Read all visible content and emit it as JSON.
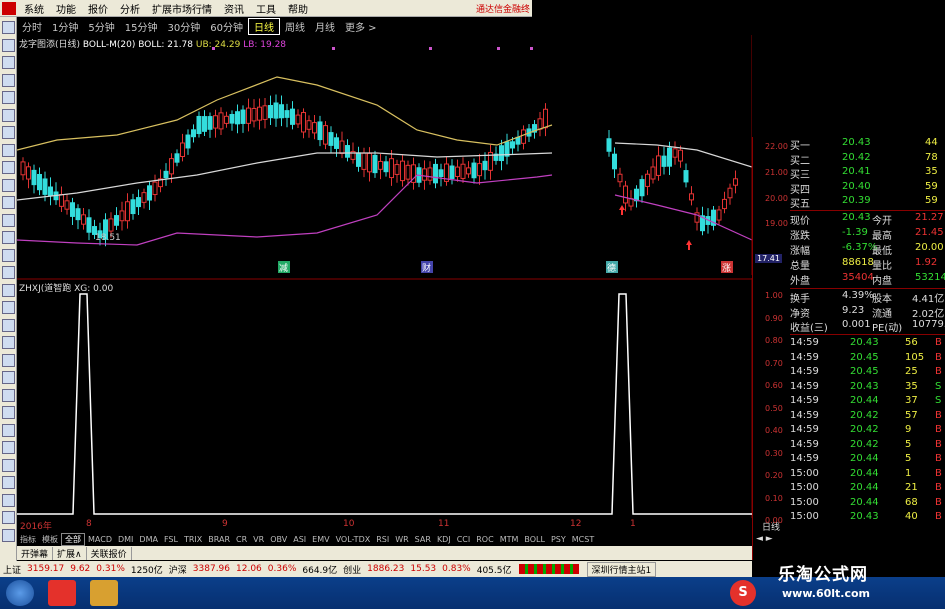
{
  "menu": {
    "items": [
      "系统",
      "功能",
      "报价",
      "分析",
      "扩展市场行情",
      "资讯",
      "工具",
      "帮助"
    ],
    "hint": "通达信金融终"
  },
  "periods": {
    "items": [
      "分时",
      "1分钟",
      "5分钟",
      "15分钟",
      "30分钟",
      "60分钟",
      "日线",
      "周线",
      "月线",
      "更多 >"
    ],
    "active_index": 6
  },
  "main_legend": {
    "indicator": "龙字图添(日线)",
    "boll_label": "BOLL-M(20) BOLL: 21.78",
    "ub_label": "UB: 24.29",
    "lb_label": "LB: 19.28"
  },
  "sub_legend": "ZHXJ(道智跑 XG: 0.00",
  "annotations": {
    "low_price": "18.51",
    "markers": [
      "减",
      "财",
      "德",
      "涨"
    ]
  },
  "date_axis": [
    "2016年",
    "8",
    "9",
    "10",
    "11",
    "12",
    "1"
  ],
  "indicator_tabs": [
    "指标",
    "模板",
    "全部",
    "MACD",
    "DMI",
    "DMA",
    "FSL",
    "TRIX",
    "BRAR",
    "CR",
    "VR",
    "OBV",
    "ASI",
    "EMV",
    "VOL-TDX",
    "RSI",
    "WR",
    "SAR",
    "KDJ",
    "CCI",
    "ROC",
    "MTM",
    "BOLL",
    "PSY",
    "MCST"
  ],
  "indicator_tab_selected": 2,
  "bottom_tabs": [
    "开弹幕",
    "扩展∧",
    "关联报价"
  ],
  "status": {
    "sh_label": "上证",
    "sh_value": "3159.17",
    "sh_change": "9.62",
    "sh_pct": "0.31%",
    "sh_amount": "1250亿",
    "sz_label": "沪深",
    "sz_value": "3387.96",
    "sz_change": "12.06",
    "sz_pct": "0.36%",
    "sz_amount": "664.9亿",
    "cy_label": "创业",
    "cy_value": "1886.23",
    "cy_change": "15.53",
    "cy_pct": "0.83%",
    "cy_amount": "405.5亿",
    "site": "深圳行情主站1"
  },
  "right_panel": {
    "price_scale": [
      "22.00",
      "21.00",
      "20.00",
      "19.00",
      "17.41"
    ],
    "sub_scale": [
      "1.00",
      "0.90",
      "0.80",
      "0.70",
      "0.60",
      "0.50",
      "0.40",
      "0.30",
      "0.20",
      "0.10",
      "0.00"
    ],
    "bids": [
      {
        "label": "买一",
        "price": "20.43",
        "vol": "44"
      },
      {
        "label": "买二",
        "price": "20.42",
        "vol": "78"
      },
      {
        "label": "买三",
        "price": "20.41",
        "vol": "35"
      },
      {
        "label": "买四",
        "price": "20.40",
        "vol": "59"
      },
      {
        "label": "买五",
        "price": "20.39",
        "vol": "59"
      }
    ],
    "quote": [
      {
        "l1": "现价",
        "v1": "20.43",
        "l2": "今开",
        "v2": "21.27"
      },
      {
        "l1": "涨跌",
        "v1": "-1.39",
        "l2": "最高",
        "v2": "21.45"
      },
      {
        "l1": "涨幅",
        "v1": "-6.37%",
        "l2": "最低",
        "v2": "20.00"
      },
      {
        "l1": "总量",
        "v1": "88618",
        "l2": "量比",
        "v2": "1.92"
      },
      {
        "l1": "外盘",
        "v1": "35404",
        "l2": "内盘",
        "v2": "53214"
      }
    ],
    "stats": [
      {
        "l1": "换手",
        "v1": "4.39%",
        "l2": "股本",
        "v2": "4.41亿"
      },
      {
        "l1": "净资",
        "v1": "9.23",
        "l2": "流通",
        "v2": "2.02亿"
      },
      {
        "l1": "收益(三)",
        "v1": "0.001",
        "l2": "PE(动)",
        "v2": "10779.9"
      }
    ],
    "ticks": [
      {
        "time": "14:59",
        "price": "20.43",
        "vol": "56",
        "dir": "B"
      },
      {
        "time": "14:59",
        "price": "20.45",
        "vol": "105",
        "dir": "B"
      },
      {
        "time": "14:59",
        "price": "20.45",
        "vol": "25",
        "dir": "B"
      },
      {
        "time": "14:59",
        "price": "20.43",
        "vol": "35",
        "dir": "S"
      },
      {
        "time": "14:59",
        "price": "20.44",
        "vol": "37",
        "dir": "S"
      },
      {
        "time": "14:59",
        "price": "20.42",
        "vol": "57",
        "dir": "B"
      },
      {
        "time": "14:59",
        "price": "20.42",
        "vol": "9",
        "dir": "B"
      },
      {
        "time": "14:59",
        "price": "20.42",
        "vol": "5",
        "dir": "B"
      },
      {
        "time": "14:59",
        "price": "20.44",
        "vol": "5",
        "dir": "B"
      },
      {
        "time": "15:00",
        "price": "20.44",
        "vol": "1",
        "dir": "B"
      },
      {
        "time": "15:00",
        "price": "20.44",
        "vol": "21",
        "dir": "B"
      },
      {
        "time": "15:00",
        "price": "20.44",
        "vol": "68",
        "dir": "B"
      },
      {
        "time": "15:00",
        "price": "20.43",
        "vol": "40",
        "dir": "B"
      }
    ],
    "side_label": "日线",
    "daily_label": "日线"
  },
  "watermark": {
    "title": "乐淘公式网",
    "url": "www.60lt.com"
  },
  "colors": {
    "up": "#e33333",
    "down": "#33dddd",
    "boll_mid": "#d8d8d8",
    "boll_upper": "#d8c060",
    "boll_lower": "#c040c0",
    "indicator_line": "#ffffff"
  }
}
